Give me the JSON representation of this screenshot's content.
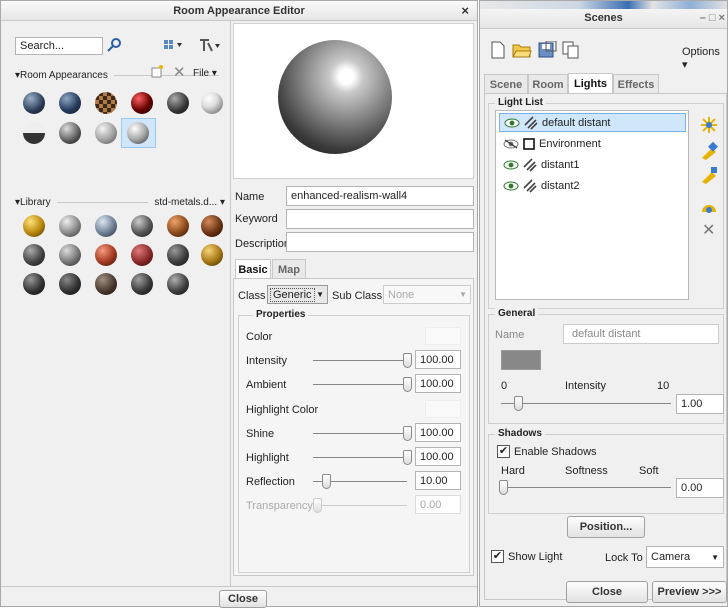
{
  "rae": {
    "title": "Room Appearance Editor",
    "close_x": "×",
    "search_placeholder": "Search...",
    "room_appearances_label": "▾Room Appearances",
    "file_label": "File ▾",
    "library_label": "▾Library",
    "library_select": "std-metals.d... ▾",
    "name_label": "Name",
    "name_value": "enhanced-realism-wall4",
    "keyword_label": "Keyword",
    "keyword_value": "",
    "description_label": "Description",
    "description_value": "",
    "tabs": [
      "Basic",
      "Map"
    ],
    "class_label": "Class",
    "class_value": "Generic",
    "subclass_label": "Sub Class",
    "subclass_value": "None",
    "properties_label": "Properties",
    "props": {
      "color_label": "Color",
      "intensity_label": "Intensity",
      "intensity_value": "100.00",
      "ambient_label": "Ambient",
      "ambient_value": "100.00",
      "highlight_color_label": "Highlight Color",
      "shine_label": "Shine",
      "shine_value": "100.00",
      "highlight_label": "Highlight",
      "highlight_value": "100.00",
      "reflection_label": "Reflection",
      "reflection_value": "10.00",
      "transparency_label": "Transparency",
      "transparency_value": "0.00"
    },
    "slider_levels": {
      "intensity": 1.0,
      "ambient": 1.0,
      "shine": 1.0,
      "highlight": 1.0,
      "reflection": 0.1,
      "transparency": 0.0
    },
    "close_button": "Close"
  },
  "scenes": {
    "title": "Scenes",
    "window_controls": "–  □  ×",
    "options_label": "Options ▾",
    "tabs": [
      "Scene",
      "Room",
      "Lights",
      "Effects"
    ],
    "light_list_label": "Light List",
    "lights": [
      {
        "name": "default distant",
        "selected": true
      },
      {
        "name": "Environment",
        "selected": false
      },
      {
        "name": "distant1",
        "selected": false
      },
      {
        "name": "distant2",
        "selected": false
      }
    ],
    "general_label": "General",
    "name_label": "Name",
    "name_value": "default distant",
    "intensity_min": "0",
    "intensity_label": "Intensity",
    "intensity_max": "10",
    "intensity_value": "1.00",
    "shadows_label": "Shadows",
    "enable_shadows_label": "Enable Shadows",
    "hard_label": "Hard",
    "softness_label": "Softness",
    "soft_label": "Soft",
    "softness_value": "0.00",
    "position_button": "Position...",
    "show_light_label": "Show Light",
    "lock_to_label": "Lock To",
    "lock_to_value": "Camera",
    "close_button": "Close",
    "preview_button": "Preview >>>",
    "colors": {
      "selection": "#cfe6fb",
      "selection_border": "#7fb0e0",
      "swatch": "#888888"
    }
  }
}
